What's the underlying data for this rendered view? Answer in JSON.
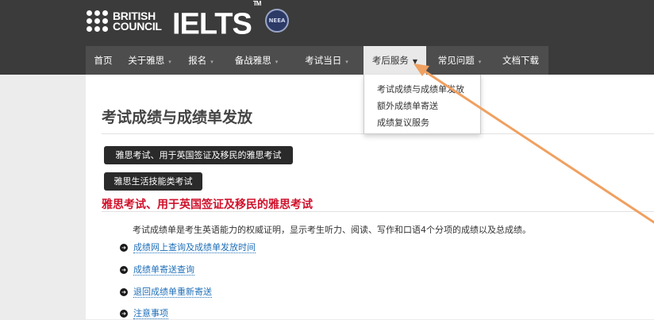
{
  "branding": {
    "bc_line1": "BRITISH",
    "bc_line2": "COUNCIL",
    "ielts": "IELTS",
    "ielts_tm": "TM",
    "seal_text": "NEEA"
  },
  "nav": {
    "items": [
      {
        "label": "首页",
        "has_caret": false
      },
      {
        "label": "关于雅思",
        "has_caret": true
      },
      {
        "label": "报名",
        "has_caret": true
      },
      {
        "label": "备战雅思",
        "has_caret": true
      },
      {
        "label": "考试当日",
        "has_caret": true
      },
      {
        "label": "考后服务",
        "has_caret": true,
        "active": true
      },
      {
        "label": "常见问题",
        "has_caret": true
      },
      {
        "label": "文档下载",
        "has_caret": false
      }
    ],
    "caret_glyph": "▾",
    "active_caret_glyph": "▼"
  },
  "dropdown": {
    "items": [
      "考试成绩与成绩单发放",
      "额外成绩单寄送",
      "成绩复议服务"
    ]
  },
  "page": {
    "title": "考试成绩与成绩单发放",
    "button_ielts_ukvi": "雅思考试、用于英国签证及移民的雅思考试",
    "button_life_skills": "雅思生活技能类考试",
    "section_heading": "雅思考试、用于英国签证及移民的雅思考试",
    "description": "考试成绩单是考生英语能力的权威证明，显示考生听力、阅读、写作和口语4个分项的成绩以及总成绩。",
    "links": [
      "成绩网上查询及成绩单发放时间",
      "成绩单寄送查询",
      "退回成绩单重新寄送",
      "注意事项"
    ],
    "link_glyph": "➜"
  },
  "colors": {
    "header_bg": "#3b3b3b",
    "nav_bg": "#4d4d4d",
    "accent_red": "#d0112b",
    "link_blue": "#1f6fb8",
    "annotation_arrow": "#f0a060"
  }
}
